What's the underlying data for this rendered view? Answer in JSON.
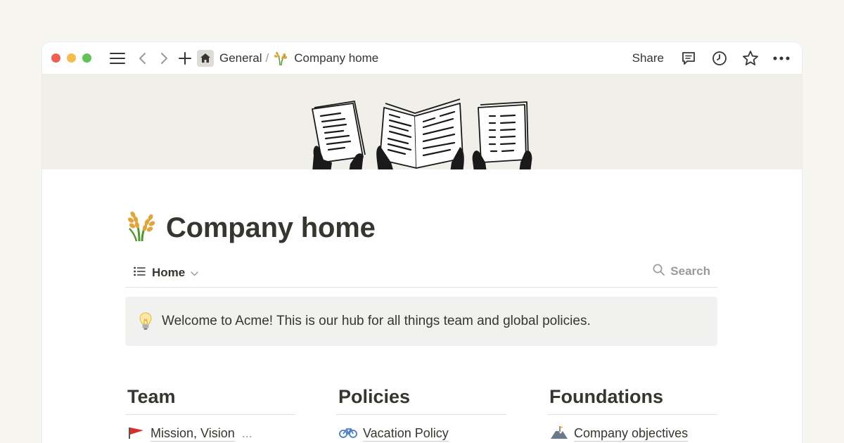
{
  "window": {
    "traffic_lights": {
      "close": "#ee5f57",
      "minimize": "#f5bd4f",
      "zoom": "#5fc453"
    },
    "toolbar": {
      "menu_icon": "hamburger-icon",
      "back_icon": "chevron-left-icon",
      "forward_icon": "chevron-right-icon",
      "new_icon": "plus-icon"
    },
    "breadcrumb": {
      "workspace_icon": "house-icon",
      "workspace": "General",
      "separator": "/",
      "page_icon": "rice-sheaf-icon",
      "page": "Company home"
    },
    "actions": {
      "share_label": "Share",
      "comments_icon": "comment-icon",
      "history_icon": "clock-icon",
      "favorite_icon": "star-icon",
      "more_icon": "ellipsis-icon"
    }
  },
  "cover": {
    "illustration": "newspaper-readers-illustration"
  },
  "page": {
    "title_icon": "rice-sheaf-icon",
    "title": "Company home",
    "view": {
      "icon": "list-icon",
      "label": "Home"
    },
    "search_label": "Search",
    "callout": {
      "icon": "lightbulb-icon",
      "text": "Welcome to Acme! This is our hub for all things team and global policies."
    },
    "columns": [
      {
        "heading": "Team",
        "items": [
          {
            "icon": "red-flag-icon",
            "label": "Mission, Vision",
            "more": "..."
          }
        ]
      },
      {
        "heading": "Policies",
        "items": [
          {
            "icon": "bicycle-icon",
            "label": "Vacation Policy"
          }
        ]
      },
      {
        "heading": "Foundations",
        "items": [
          {
            "icon": "mountain-icon",
            "label": "Company objectives"
          }
        ]
      }
    ]
  },
  "colors": {
    "background": "#f7f5f0",
    "text": "#37352f",
    "muted": "#9b9a97",
    "callout_bg": "#f1f1ef",
    "cover_bg": "#f1efea"
  }
}
